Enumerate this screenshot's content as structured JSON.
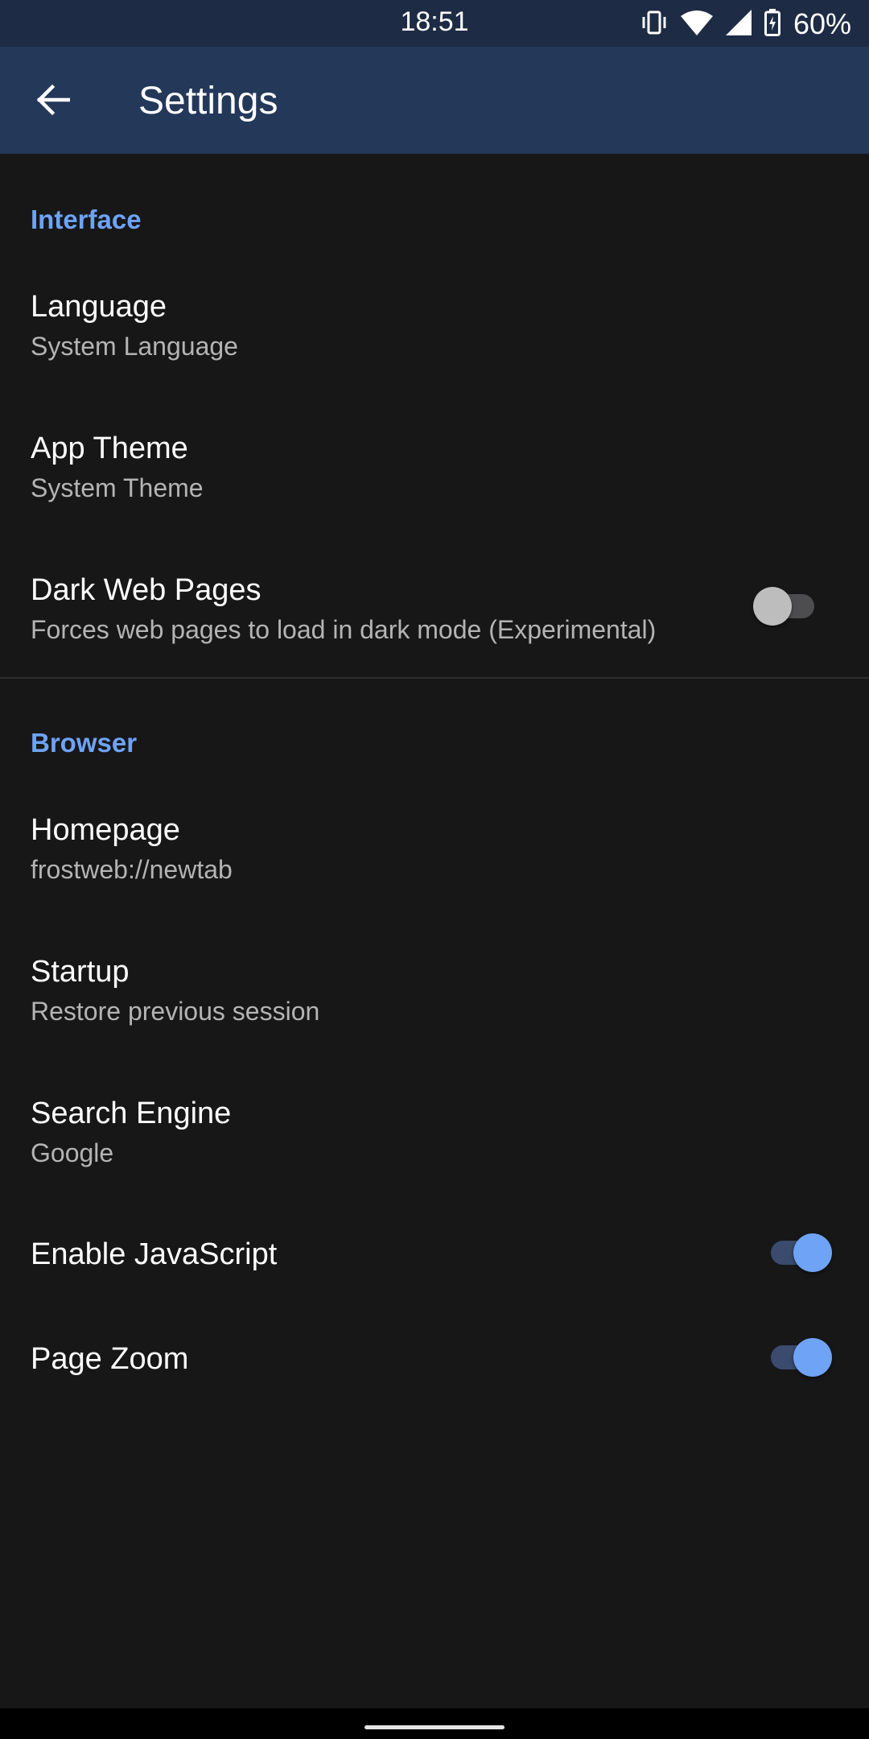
{
  "status_bar": {
    "time": "18:51",
    "battery_pct": "60%",
    "icons": [
      "vibrate-icon",
      "wifi-icon",
      "signal-icon",
      "battery-charging-icon"
    ]
  },
  "app_bar": {
    "title": "Settings",
    "back_icon": "arrow-back-icon"
  },
  "colors": {
    "accent": "#6ea3f5",
    "app_bar": "#24385a",
    "status_bar": "#1d2b44",
    "background": "#171718"
  },
  "sections": {
    "interface": {
      "header": "Interface",
      "language": {
        "title": "Language",
        "summary": "System Language"
      },
      "app_theme": {
        "title": "App Theme",
        "summary": "System Theme"
      },
      "dark_web_pages": {
        "title": "Dark Web Pages",
        "summary": "Forces web pages to load in dark mode (Experimental)",
        "enabled": false
      }
    },
    "browser": {
      "header": "Browser",
      "homepage": {
        "title": "Homepage",
        "summary": "frostweb://newtab"
      },
      "startup": {
        "title": "Startup",
        "summary": "Restore previous session"
      },
      "search_engine": {
        "title": "Search Engine",
        "summary": "Google"
      },
      "javascript": {
        "title": "Enable JavaScript",
        "enabled": true
      },
      "page_zoom": {
        "title": "Page Zoom",
        "enabled": true
      }
    }
  }
}
